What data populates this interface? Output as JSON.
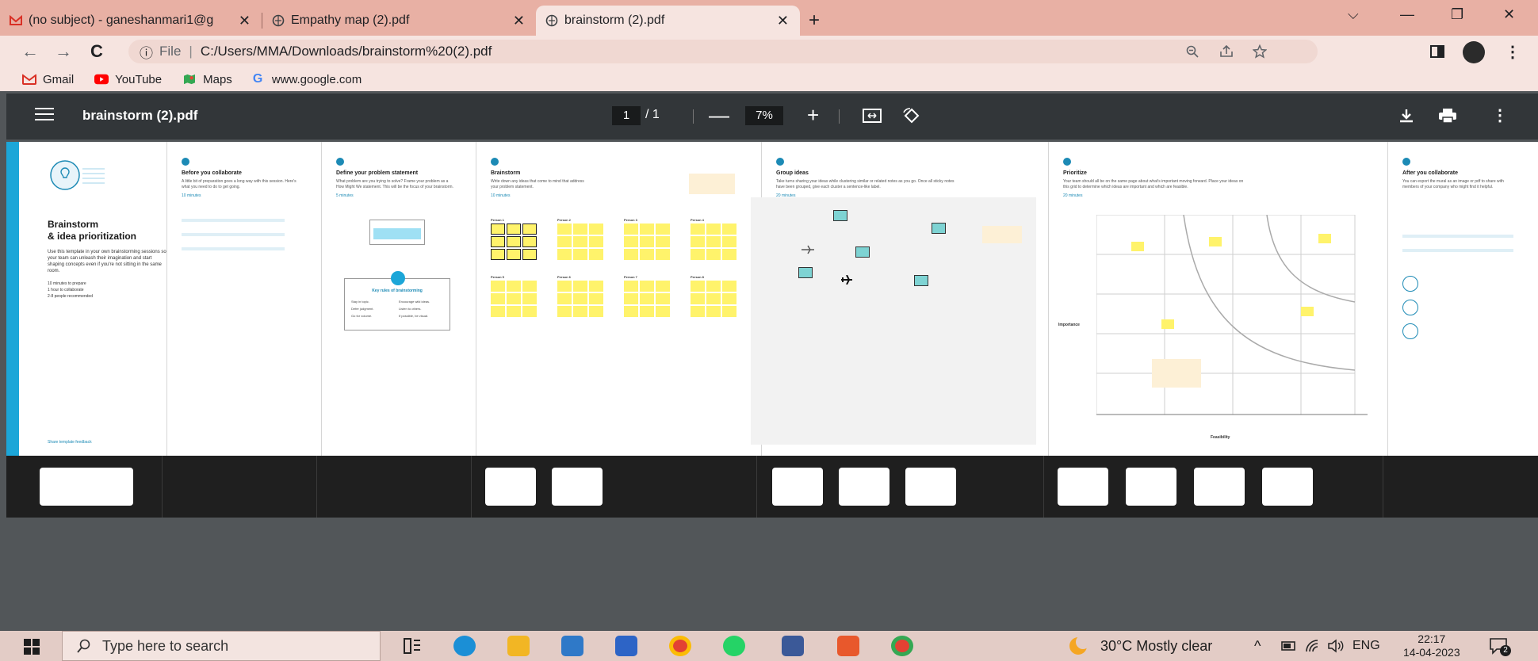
{
  "tabs": [
    {
      "title": "(no subject) - ganeshanmari1@g",
      "icon": "gmail-icon"
    },
    {
      "title": "Empathy map (2).pdf",
      "icon": "globe-icon"
    },
    {
      "title": "brainstorm (2).pdf",
      "icon": "globe-icon",
      "active": true
    }
  ],
  "tab_close": "✕",
  "new_tab": "+",
  "window": {
    "dropdown": "⌵",
    "minimize": "—",
    "restore": "❐",
    "close": "✕"
  },
  "nav": {
    "back": "←",
    "forward": "→",
    "reload": "C"
  },
  "address": {
    "scheme_icon": "ⓘ",
    "scheme_label": "File",
    "url": "C:/Users/MMA/Downloads/brainstorm%20(2).pdf"
  },
  "bookmarks": [
    {
      "label": "Gmail",
      "icon": "gmail-icon",
      "color": "#d93025"
    },
    {
      "label": "YouTube",
      "icon": "youtube-icon",
      "color": "#ff0000"
    },
    {
      "label": "Maps",
      "icon": "maps-icon",
      "color": "#34a853"
    },
    {
      "label": "www.google.com",
      "icon": "google-icon",
      "color": "#4285f4"
    }
  ],
  "pdf": {
    "title": "brainstorm (2).pdf",
    "page_current": "1",
    "page_total": "/ 1",
    "zoom": "7%",
    "zoom_out": "—",
    "zoom_in": "+"
  },
  "board": {
    "intro": {
      "title_line1": "Brainstorm",
      "title_line2": "& idea prioritization",
      "body": "Use this template in your own brainstorming sessions so your team can unleash their imagination and start shaping concepts even if you're not sitting in the same room.",
      "meta": [
        "10 minutes to prepare",
        "1 hour to collaborate",
        "2-8 people recommended"
      ],
      "feedback": "Share template feedback"
    },
    "frames": [
      {
        "title": "Before you collaborate",
        "desc": "A little bit of preparation goes a long way with this session. Here's what you need to do to get going.",
        "time": "10 minutes"
      },
      {
        "title": "Define your problem statement",
        "desc": "What problem are you trying to solve? Frame your problem as a How Might We statement. This will be the focus of your brainstorm.",
        "time": "5 minutes"
      },
      {
        "title": "Brainstorm",
        "desc": "Write down any ideas that come to mind that address your problem statement.",
        "time": "10 minutes"
      },
      {
        "title": "Group ideas",
        "desc": "Take turns sharing your ideas while clustering similar or related notes as you go. Once all sticky notes have been grouped, give each cluster a sentence-like label.",
        "time": "20 minutes"
      },
      {
        "title": "Prioritize",
        "desc": "Your team should all be on the same page about what's important moving forward. Place your ideas on this grid to determine which ideas are important and which are feasible.",
        "time": "20 minutes"
      },
      {
        "title": "After you collaborate",
        "desc": "You can export the mural as an image or pdf to share with members of your company who might find it helpful.",
        "time": ""
      }
    ],
    "persons": [
      "Person 1",
      "Person 2",
      "Person 3",
      "Person 4",
      "Person 5",
      "Person 6",
      "Person 7",
      "Person 8"
    ],
    "rules_title": "Key rules of brainstorming",
    "rules": [
      "Stay in topic.",
      "Encourage wild ideas.",
      "Defer judgment.",
      "Listen to others.",
      "Go for volume.",
      "If possible, be visual."
    ],
    "axis_importance": "Importance",
    "axis_feasibility": "Feasibility"
  },
  "taskbar": {
    "search_placeholder": "Type here to search",
    "weather": "30°C  Mostly clear",
    "lang": "ENG",
    "time": "22:17",
    "date": "14-04-2023",
    "notifications": "2"
  }
}
